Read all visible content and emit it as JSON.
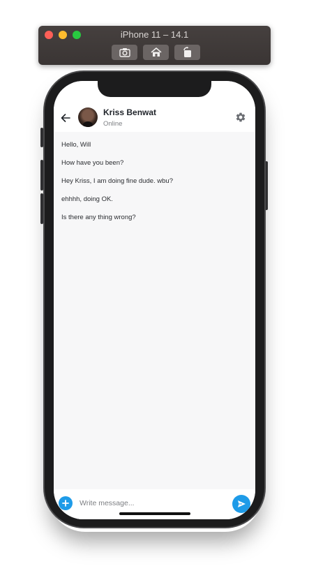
{
  "simulator": {
    "title": "iPhone 11 – 14.1",
    "toolbar": [
      "screenshot-icon",
      "home-icon",
      "rotate-icon"
    ]
  },
  "chat": {
    "contact_name": "Kriss Benwat",
    "contact_status": "Online",
    "messages": [
      "Hello, Will",
      "How have you been?",
      "Hey Kriss, I am doing fine dude. wbu?",
      "ehhhh, doing OK.",
      "Is there any thing wrong?"
    ]
  },
  "composer": {
    "placeholder": "Write message..."
  },
  "colors": {
    "accent": "#1e9be8",
    "background": "#f7f7f8",
    "header": "#ffffff"
  }
}
